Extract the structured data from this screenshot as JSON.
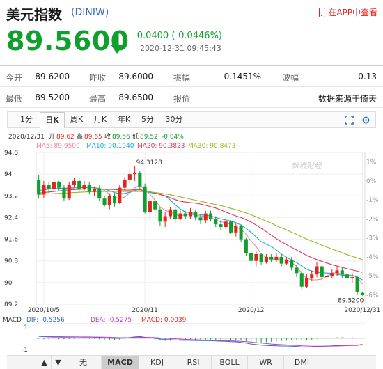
{
  "header": {
    "title": "美元指数",
    "code": "(DINIW)",
    "app_link": "在APP中查看"
  },
  "quote": {
    "price": "89.5600",
    "change": "-0.0400",
    "change_pct": "(-0.0446%)",
    "datetime": "2020-12-31 09:45:43",
    "colors": {
      "down": "#0e9f2c",
      "up": "#e1251b"
    }
  },
  "stats": {
    "rows": [
      [
        {
          "label": "今开",
          "value": "89.6200"
        },
        {
          "label": "昨收",
          "value": "89.6000"
        },
        {
          "label": "振幅",
          "value": "0.1451%"
        },
        {
          "label": "波幅",
          "value": "0.13"
        }
      ],
      [
        {
          "label": "最低",
          "value": "89.5200"
        },
        {
          "label": "最高",
          "value": "89.6500"
        },
        {
          "label": "报价",
          "value": ""
        },
        {
          "label": "",
          "value": "数据来源于倚天"
        }
      ]
    ]
  },
  "period_tabs": [
    "1分",
    "日K",
    "周K",
    "月K",
    "年K",
    "5分",
    "30分"
  ],
  "active_period": "日K",
  "toolbar_icons": [
    "fullscreen-icon",
    "settings-icon"
  ],
  "info_line": {
    "date": "2020/12/31",
    "open_label": "开",
    "open": "89.62",
    "high_label": "高",
    "high": "89.65",
    "close_label": "收",
    "close": "89.56",
    "low_label": "低",
    "low": "89.52",
    "change": "-0.04%"
  },
  "ma_line": {
    "ma5": "MA5: 89.9500",
    "ma10": "MA10: 90.1040",
    "ma20": "MA20: 90.3823",
    "ma30": "MA30: 90.8473"
  },
  "macd_line": {
    "name": "MACD",
    "dif": "DIF: -0.5256",
    "dea": "DEA: -0.5275",
    "macd": "MACD: 0.0039"
  },
  "watermark": "新浪财经",
  "indicator_tabs": [
    "无",
    "MACD",
    "KDJ",
    "RSI",
    "BOLL",
    "WR",
    "DMI"
  ],
  "active_indicator": "MACD",
  "chart_data": {
    "type": "candlestick",
    "y_ticks": [
      "94.8",
      "94",
      "93.2",
      "92.4",
      "91.6",
      "90.8",
      "90",
      "89.2"
    ],
    "ylim": [
      89.2,
      94.8
    ],
    "pct_ticks": [
      "1%",
      "0%",
      "-1%",
      "-2%",
      "-3%",
      "-4%",
      "-5%",
      "-6%"
    ],
    "pct_range": [
      1.5,
      -6.5
    ],
    "x_labels": [
      {
        "index": 1,
        "label": "2020/10/5"
      },
      {
        "index": 21,
        "label": "2020/11"
      },
      {
        "index": 42,
        "label": "2020/12"
      },
      {
        "index": 64,
        "label": "2020/12/31"
      }
    ],
    "annotations": [
      {
        "index": 19,
        "label": "94.3128",
        "value": 94.31
      },
      {
        "index": 64,
        "label": "89.5200",
        "value": 89.52
      }
    ],
    "candles": [
      [
        93.8,
        93.25,
        93.95,
        93.1
      ],
      [
        93.25,
        93.6,
        93.75,
        93.1
      ],
      [
        93.6,
        93.45,
        93.7,
        93.3
      ],
      [
        93.45,
        93.7,
        93.85,
        93.35
      ],
      [
        93.7,
        93.5,
        93.75,
        93.4
      ],
      [
        93.5,
        93.1,
        93.6,
        93.0
      ],
      [
        93.1,
        93.6,
        93.7,
        93.05
      ],
      [
        93.6,
        93.75,
        93.85,
        93.5
      ],
      [
        93.75,
        93.45,
        93.85,
        93.35
      ],
      [
        93.45,
        93.6,
        93.75,
        93.4
      ],
      [
        93.6,
        93.35,
        93.7,
        93.25
      ],
      [
        93.35,
        93.45,
        93.55,
        93.2
      ],
      [
        93.45,
        93.1,
        93.6,
        93.0
      ],
      [
        93.1,
        92.85,
        93.2,
        92.8
      ],
      [
        92.85,
        93.2,
        93.3,
        92.7
      ],
      [
        93.2,
        92.95,
        93.3,
        92.8
      ],
      [
        92.95,
        93.5,
        93.6,
        92.9
      ],
      [
        93.5,
        93.8,
        93.9,
        93.4
      ],
      [
        93.8,
        94.0,
        94.2,
        93.65
      ],
      [
        94.0,
        94.05,
        94.31,
        93.75
      ],
      [
        94.05,
        93.55,
        94.1,
        93.45
      ],
      [
        93.55,
        92.6,
        93.65,
        92.55
      ],
      [
        92.6,
        93.0,
        93.1,
        92.3
      ],
      [
        93.0,
        92.7,
        93.05,
        92.45
      ],
      [
        92.7,
        92.25,
        92.8,
        92.1
      ],
      [
        92.25,
        92.45,
        92.6,
        92.05
      ],
      [
        92.45,
        92.7,
        92.8,
        92.35
      ],
      [
        92.7,
        92.35,
        92.8,
        92.2
      ],
      [
        92.35,
        92.55,
        92.65,
        92.3
      ],
      [
        92.55,
        92.45,
        92.65,
        92.35
      ],
      [
        92.45,
        92.6,
        92.75,
        92.35
      ],
      [
        92.6,
        92.4,
        92.7,
        92.3
      ],
      [
        92.4,
        92.3,
        92.5,
        92.15
      ],
      [
        92.3,
        92.55,
        92.65,
        92.2
      ],
      [
        92.55,
        92.35,
        92.65,
        92.25
      ],
      [
        92.35,
        92.15,
        92.45,
        92.05
      ],
      [
        92.15,
        92.05,
        92.3,
        91.95
      ],
      [
        92.05,
        92.25,
        92.35,
        91.95
      ],
      [
        92.25,
        91.85,
        92.3,
        91.8
      ],
      [
        91.85,
        92.1,
        92.2,
        91.7
      ],
      [
        92.1,
        91.6,
        92.15,
        91.5
      ],
      [
        91.6,
        91.1,
        91.65,
        91.0
      ],
      [
        91.1,
        90.8,
        91.2,
        90.7
      ],
      [
        90.8,
        91.05,
        91.15,
        90.6
      ],
      [
        91.05,
        90.75,
        91.1,
        90.65
      ],
      [
        90.75,
        90.95,
        91.05,
        90.7
      ],
      [
        90.95,
        90.85,
        91.05,
        90.75
      ],
      [
        90.85,
        90.95,
        91.1,
        90.75
      ],
      [
        90.95,
        90.7,
        91.05,
        90.6
      ],
      [
        90.7,
        90.85,
        90.95,
        90.65
      ],
      [
        90.85,
        90.55,
        90.95,
        90.45
      ],
      [
        90.55,
        90.35,
        90.65,
        90.2
      ],
      [
        90.35,
        89.85,
        90.45,
        89.75
      ],
      [
        89.85,
        90.15,
        90.3,
        89.8
      ],
      [
        90.15,
        90.3,
        90.45,
        90.05
      ],
      [
        90.3,
        90.6,
        90.75,
        90.2
      ],
      [
        90.6,
        90.2,
        90.65,
        90.05
      ],
      [
        90.2,
        90.25,
        90.4,
        90.1
      ],
      [
        90.25,
        90.35,
        90.5,
        90.15
      ],
      [
        90.35,
        90.45,
        90.6,
        90.25
      ],
      [
        90.45,
        90.3,
        90.55,
        90.15
      ],
      [
        90.3,
        90.15,
        90.4,
        90.05
      ],
      [
        90.15,
        90.2,
        90.35,
        90.0
      ],
      [
        90.2,
        89.65,
        90.25,
        89.55
      ],
      [
        89.62,
        89.56,
        89.65,
        89.52
      ]
    ],
    "ma_series": [
      {
        "name": "MA5",
        "color": "#e8849a",
        "values": [
          93.55,
          93.5,
          93.48,
          93.46,
          93.47,
          93.48,
          93.49,
          93.52,
          93.54,
          93.52,
          93.52,
          93.5,
          93.48,
          93.4,
          93.25,
          93.15,
          93.1,
          93.15,
          93.3,
          93.49,
          93.6,
          93.42,
          93.25,
          93.04,
          92.8,
          92.66,
          92.61,
          92.51,
          92.46,
          92.5,
          92.52,
          92.48,
          92.46,
          92.44,
          92.4,
          92.31,
          92.24,
          92.22,
          92.13,
          92.04,
          91.97,
          91.79,
          91.53,
          91.33,
          91.05,
          90.92,
          90.88,
          90.85,
          90.85,
          90.83,
          90.74,
          90.6,
          90.34,
          90.15,
          90.1,
          90.1,
          90.13,
          90.24,
          90.35,
          90.36,
          90.31,
          90.26,
          90.27,
          90.21,
          89.95
        ]
      },
      {
        "name": "MA10",
        "color": "#1aa6d9",
        "values": [
          93.4,
          93.42,
          93.45,
          93.46,
          93.48,
          93.48,
          93.48,
          93.49,
          93.5,
          93.5,
          93.5,
          93.49,
          93.47,
          93.44,
          93.39,
          93.32,
          93.28,
          93.29,
          93.33,
          93.39,
          93.45,
          93.36,
          93.32,
          93.29,
          93.25,
          93.2,
          93.05,
          92.87,
          92.71,
          92.6,
          92.58,
          92.55,
          92.5,
          92.48,
          92.46,
          92.4,
          92.35,
          92.31,
          92.27,
          92.21,
          92.12,
          92.0,
          91.85,
          91.69,
          91.51,
          91.42,
          91.33,
          91.2,
          91.05,
          90.93,
          90.83,
          90.74,
          90.61,
          90.49,
          90.42,
          90.38,
          90.36,
          90.35,
          90.34,
          90.3,
          90.27,
          90.25,
          90.25,
          90.2,
          90.1
        ]
      },
      {
        "name": "MA20",
        "color": "#e0335e",
        "values": [
          93.3,
          93.32,
          93.34,
          93.36,
          93.38,
          93.4,
          93.42,
          93.43,
          93.44,
          93.45,
          93.45,
          93.45,
          93.45,
          93.45,
          93.44,
          93.43,
          93.42,
          93.41,
          93.41,
          93.42,
          93.42,
          93.39,
          93.35,
          93.3,
          93.25,
          93.2,
          93.13,
          93.06,
          93.0,
          92.97,
          92.95,
          92.93,
          92.9,
          92.85,
          92.8,
          92.75,
          92.68,
          92.6,
          92.53,
          92.46,
          92.4,
          92.32,
          92.23,
          92.12,
          92.0,
          91.88,
          91.75,
          91.62,
          91.5,
          91.4,
          91.3,
          91.2,
          91.1,
          91.0,
          90.92,
          90.85,
          90.78,
          90.72,
          90.66,
          90.61,
          90.56,
          90.51,
          90.47,
          90.42,
          90.38
        ]
      },
      {
        "name": "MA30",
        "color": "#9ab81e",
        "values": [
          93.25,
          93.26,
          93.27,
          93.28,
          93.29,
          93.3,
          93.31,
          93.32,
          93.33,
          93.34,
          93.35,
          93.35,
          93.36,
          93.36,
          93.36,
          93.36,
          93.36,
          93.36,
          93.36,
          93.36,
          93.36,
          93.35,
          93.34,
          93.32,
          93.3,
          93.27,
          93.24,
          93.2,
          93.16,
          93.12,
          93.08,
          93.04,
          93.0,
          92.96,
          92.92,
          92.88,
          92.84,
          92.79,
          92.74,
          92.69,
          92.63,
          92.57,
          92.5,
          92.43,
          92.35,
          92.27,
          92.19,
          92.1,
          92.02,
          91.94,
          91.86,
          91.78,
          91.69,
          91.61,
          91.53,
          91.46,
          91.38,
          91.31,
          91.24,
          91.17,
          91.1,
          91.03,
          90.97,
          90.91,
          90.85
        ]
      }
    ],
    "macd": {
      "y_ticks": [
        "1",
        "-1"
      ],
      "ylim": [
        -1.3,
        1.3
      ],
      "dif": [
        0.18,
        0.15,
        0.13,
        0.12,
        0.12,
        0.11,
        0.11,
        0.12,
        0.12,
        0.11,
        0.11,
        0.1,
        0.08,
        0.05,
        0.02,
        0.0,
        0.0,
        0.03,
        0.08,
        0.13,
        0.16,
        0.1,
        0.05,
        0.0,
        -0.06,
        -0.1,
        -0.12,
        -0.15,
        -0.17,
        -0.18,
        -0.18,
        -0.19,
        -0.2,
        -0.2,
        -0.21,
        -0.23,
        -0.25,
        -0.26,
        -0.29,
        -0.31,
        -0.35,
        -0.42,
        -0.5,
        -0.55,
        -0.6,
        -0.63,
        -0.65,
        -0.66,
        -0.68,
        -0.68,
        -0.7,
        -0.72,
        -0.77,
        -0.78,
        -0.76,
        -0.72,
        -0.71,
        -0.69,
        -0.66,
        -0.63,
        -0.61,
        -0.6,
        -0.58,
        -0.6,
        -0.53
      ],
      "dea": [
        0.2,
        0.19,
        0.18,
        0.17,
        0.16,
        0.15,
        0.14,
        0.14,
        0.13,
        0.13,
        0.13,
        0.12,
        0.12,
        0.11,
        0.09,
        0.08,
        0.06,
        0.06,
        0.06,
        0.07,
        0.09,
        0.09,
        0.08,
        0.07,
        0.04,
        0.01,
        -0.02,
        -0.04,
        -0.07,
        -0.09,
        -0.11,
        -0.12,
        -0.14,
        -0.15,
        -0.16,
        -0.17,
        -0.19,
        -0.2,
        -0.22,
        -0.24,
        -0.26,
        -0.29,
        -0.33,
        -0.38,
        -0.42,
        -0.46,
        -0.5,
        -0.53,
        -0.56,
        -0.58,
        -0.61,
        -0.63,
        -0.66,
        -0.68,
        -0.7,
        -0.7,
        -0.7,
        -0.7,
        -0.69,
        -0.68,
        -0.66,
        -0.65,
        -0.64,
        -0.63,
        -0.53
      ]
    }
  }
}
